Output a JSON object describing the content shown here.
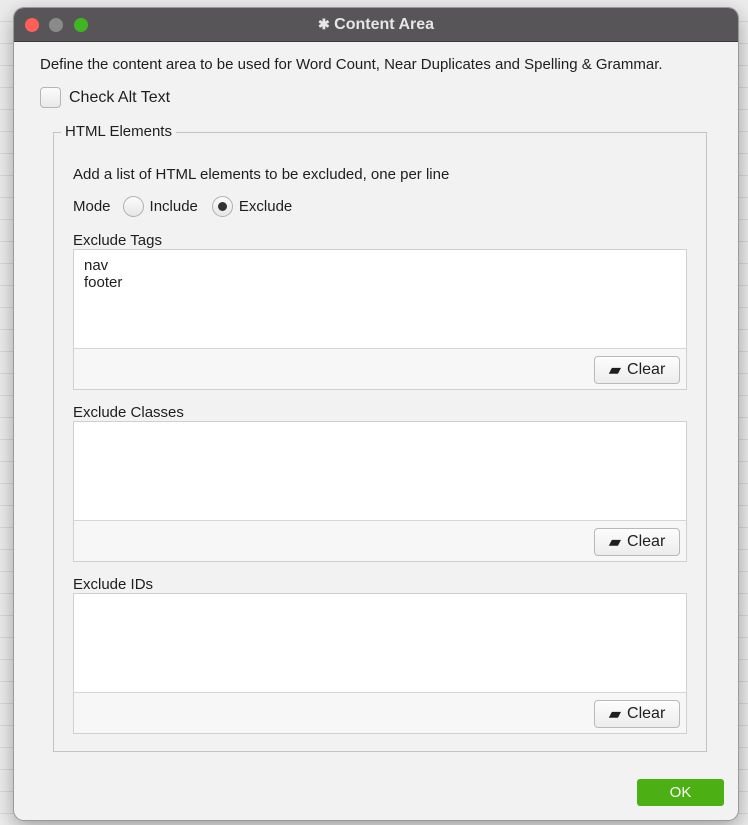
{
  "dialog": {
    "title": "Content Area",
    "description": "Define the content area to be used for Word Count, Near Duplicates and Spelling & Grammar.",
    "check_alt_text": {
      "label": "Check Alt Text",
      "checked": false
    },
    "group": {
      "legend": "HTML Elements",
      "instructions": "Add a list of HTML elements to be excluded, one per line",
      "mode": {
        "label": "Mode",
        "options": [
          "Include",
          "Exclude"
        ],
        "selected": "Exclude"
      },
      "fields": [
        {
          "label": "Exclude Tags",
          "value": "nav\nfooter",
          "clear_label": "Clear"
        },
        {
          "label": "Exclude Classes",
          "value": "",
          "clear_label": "Clear"
        },
        {
          "label": "Exclude IDs",
          "value": "",
          "clear_label": "Clear"
        }
      ]
    },
    "ok_label": "OK"
  },
  "colors": {
    "close": "#fe5f57",
    "minimize": "#8a8a8a",
    "zoom": "#3fb524",
    "ok": "#4caf14",
    "titlebar": "#575558"
  }
}
